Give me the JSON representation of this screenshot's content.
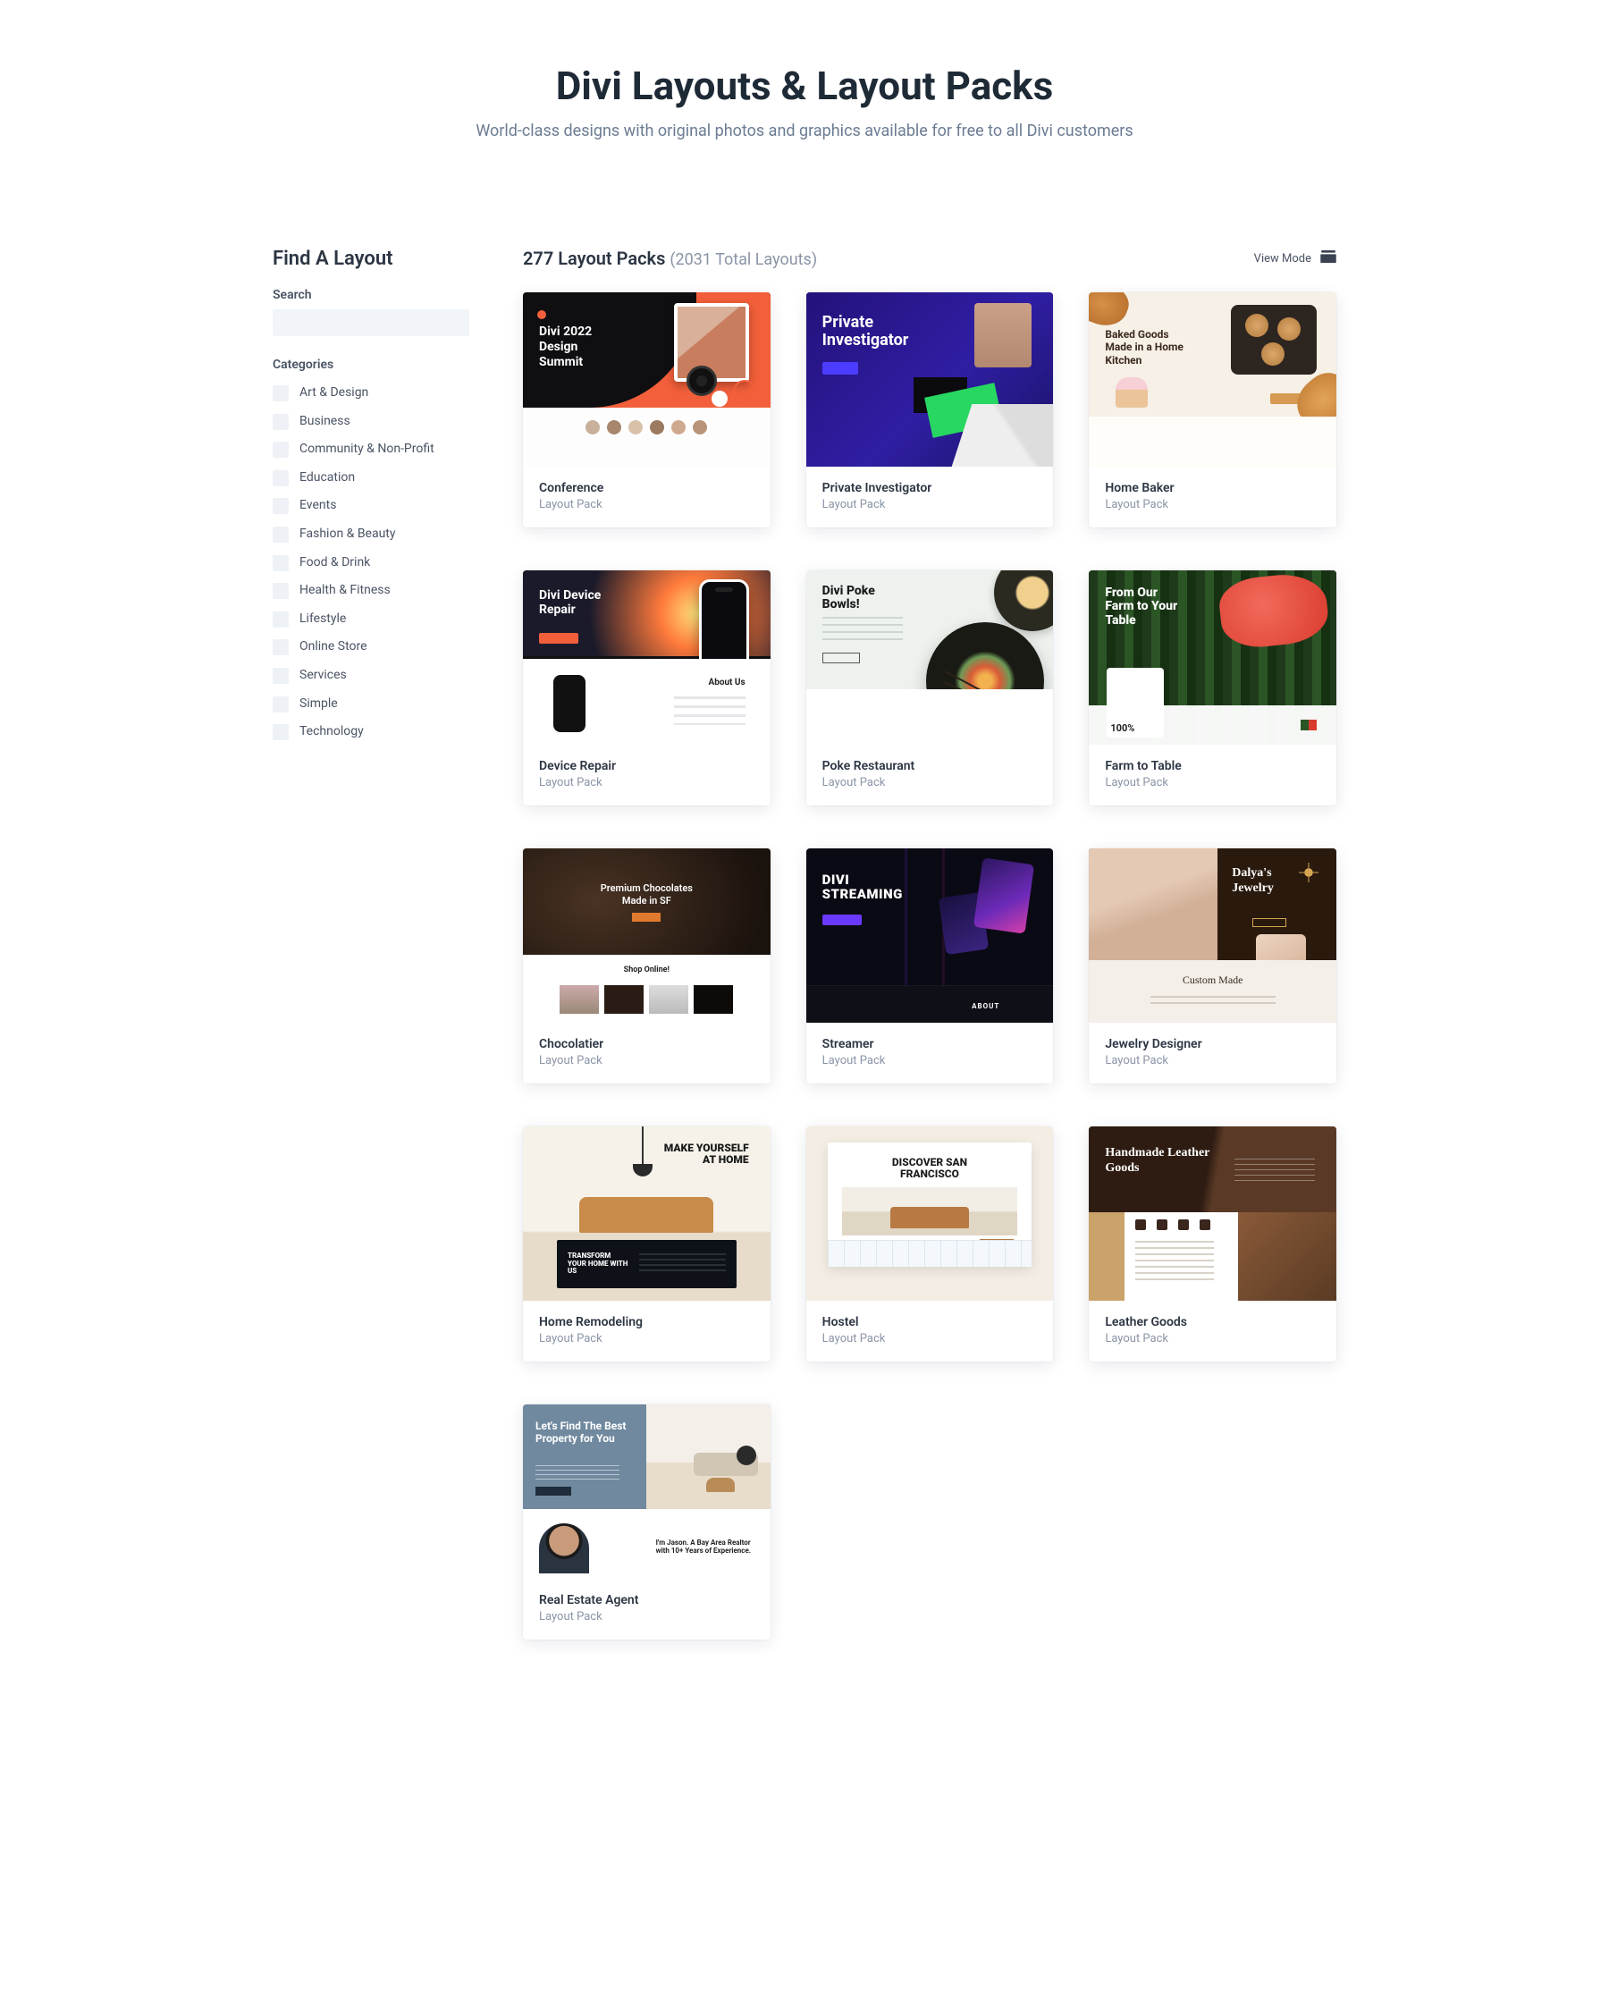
{
  "hero": {
    "title": "Divi Layouts & Layout Packs",
    "subtitle": "World-class designs with original photos and graphics available for free to all Divi customers"
  },
  "sidebar": {
    "title": "Find A Layout",
    "search_label": "Search",
    "search_value": "",
    "categories_label": "Categories",
    "categories": [
      "Art & Design",
      "Business",
      "Community & Non-Profit",
      "Education",
      "Events",
      "Fashion & Beauty",
      "Food & Drink",
      "Health & Fitness",
      "Lifestyle",
      "Online Store",
      "Services",
      "Simple",
      "Technology"
    ]
  },
  "header": {
    "count_prefix": "277 Layout Packs",
    "count_suffix": "(2031 Total Layouts)",
    "view_mode_label": "View Mode"
  },
  "card_sub_label": "Layout Pack",
  "cards": [
    {
      "title": "Conference",
      "thumb_texts": {
        "headline": "Divi 2022\nDesign\nSummit"
      }
    },
    {
      "title": "Private Investigator",
      "thumb_texts": {
        "headline": "Private\nInvestigator"
      }
    },
    {
      "title": "Home Baker",
      "thumb_texts": {
        "headline": "Baked Goods Made in a Home Kitchen"
      }
    },
    {
      "title": "Device Repair",
      "thumb_texts": {
        "headline": "Divi Device\nRepair",
        "section": "About Us"
      }
    },
    {
      "title": "Poke Restaurant",
      "thumb_texts": {
        "headline": "Divi Poke\nBowls!"
      }
    },
    {
      "title": "Farm to Table",
      "thumb_texts": {
        "headline": "From Our Farm to Your Table",
        "stat": "100%"
      }
    },
    {
      "title": "Chocolatier",
      "thumb_texts": {
        "headline": "Premium Chocolates\nMade in SF",
        "section": "Shop Online!"
      }
    },
    {
      "title": "Streamer",
      "thumb_texts": {
        "headline": "DIVI\nSTREAMING",
        "section": "ABOUT"
      }
    },
    {
      "title": "Jewelry Designer",
      "thumb_texts": {
        "headline": "Dalya's\nJewelry",
        "section": "Custom Made"
      }
    },
    {
      "title": "Home Remodeling",
      "thumb_texts": {
        "headline": "MAKE YOURSELF AT HOME",
        "section": "TRANSFORM YOUR HOME WITH US"
      }
    },
    {
      "title": "Hostel",
      "thumb_texts": {
        "headline": "DISCOVER SAN\nFRANCISCO"
      }
    },
    {
      "title": "Leather Goods",
      "thumb_texts": {
        "headline": "Handmade Leather Goods"
      }
    },
    {
      "title": "Real Estate Agent",
      "thumb_texts": {
        "headline": "Let's Find The Best Property for You",
        "bio": "I'm Jason. A Bay Area Realtor with 10+ Years of Experience."
      }
    }
  ]
}
